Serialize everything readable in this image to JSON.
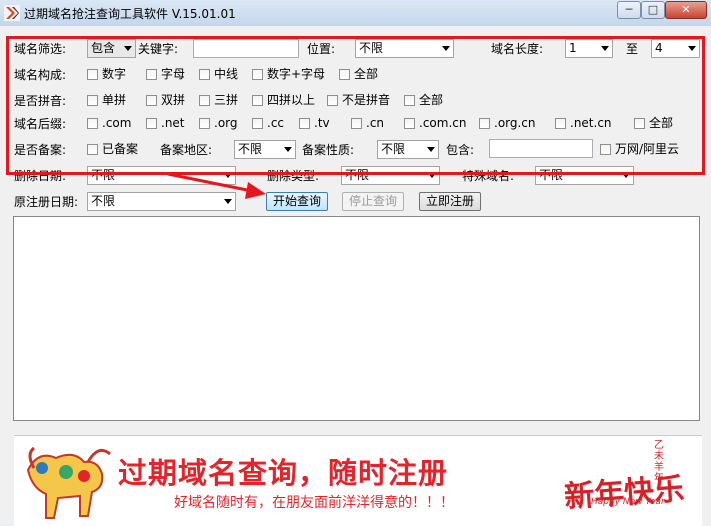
{
  "window": {
    "title": "过期域名抢注查询工具软件 V.15.01.01",
    "controls": [
      "─",
      "□",
      "✕"
    ]
  },
  "filters": {
    "domain_filter": {
      "label": "域名筛选:",
      "value": "包含"
    },
    "keyword": {
      "label": "关键字:",
      "value": ""
    },
    "position": {
      "label": "位置:",
      "value": "不限"
    },
    "length": {
      "label": "域名长度:",
      "from": "1",
      "to_label": "至",
      "to": "4"
    },
    "composition": {
      "label": "域名构成:",
      "options": [
        "数字",
        "字母",
        "中线",
        "数字+字母",
        "全部"
      ]
    },
    "pinyin": {
      "label": "是否拼音:",
      "options": [
        "单拼",
        "双拼",
        "三拼",
        "四拼以上",
        "不是拼音",
        "全部"
      ]
    },
    "suffix": {
      "label": "域名后缀:",
      "options": [
        ".com",
        ".net",
        ".org",
        ".cc",
        ".tv",
        ".cn",
        ".com.cn",
        ".org.cn",
        ".net.cn",
        "全部"
      ]
    },
    "icp": {
      "label": "是否备案:",
      "option": "已备案",
      "region_label": "备案地区:",
      "region_value": "不限",
      "nature_label": "备案性质:",
      "nature_value": "不限",
      "contains_label": "包含:",
      "contains_value": "",
      "wanwang": "万网/阿里云"
    },
    "delete_date": {
      "label": "删除日期:",
      "value": "不限"
    },
    "delete_type": {
      "label": "删除类型:",
      "value": "不限"
    },
    "special": {
      "label": "特殊域名:",
      "value": "不限"
    },
    "orig_date": {
      "label": "原注册日期:",
      "value": "不限"
    }
  },
  "buttons": {
    "start": "开始查询",
    "stop": "停止查询",
    "register": "立即注册"
  },
  "banner": {
    "title": "过期域名查询，随时注册",
    "subtitle": "好域名随时有，在朋友面前洋洋得意的！！！",
    "new_year": "新年快乐",
    "year_mark": "乙未羊年",
    "english": "Happy New Year"
  },
  "colors": {
    "highlight_red": "#e5161d",
    "banner_red": "#e5232b"
  }
}
